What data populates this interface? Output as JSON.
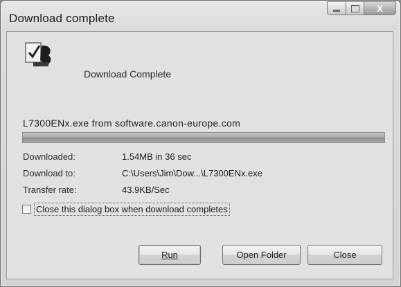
{
  "window": {
    "title": "Download complete"
  },
  "header": {
    "icon": "download-complete-icon",
    "text": "Download Complete"
  },
  "source": "L7300ENx.exe from software.canon-europe.com",
  "progress": {
    "fraction": 1.0
  },
  "details": {
    "downloaded_label": "Downloaded:",
    "downloaded_value": "1.54MB in 36 sec",
    "download_to_label": "Download to:",
    "download_to_value": "C:\\Users\\Jim\\Dow...\\L7300ENx.exe",
    "transfer_rate_label": "Transfer rate:",
    "transfer_rate_value": "43.9KB/Sec"
  },
  "option": {
    "close_when_complete_label": "Close this dialog box when download completes",
    "checked": false
  },
  "buttons": {
    "run": "Run",
    "open_folder": "Open Folder",
    "close": "Close"
  },
  "caption_buttons": {
    "close_glyph": "X"
  }
}
